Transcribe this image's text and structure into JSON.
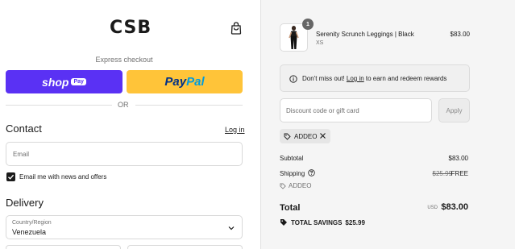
{
  "brand": {
    "logo_text": "CSB"
  },
  "express": {
    "label": "Express checkout",
    "shop_word": "shop",
    "shop_badge": "Pay",
    "paypal_a": "Pay",
    "paypal_b": "Pal",
    "or_text": "OR"
  },
  "contact": {
    "heading": "Contact",
    "login_label": "Log in",
    "email_placeholder": "Email",
    "newsletter_label": "Email me with news and offers",
    "newsletter_checked": true
  },
  "delivery": {
    "heading": "Delivery",
    "country_label": "Country/Region",
    "country_value": "Venezuela"
  },
  "summary": {
    "item": {
      "quantity": "1",
      "name": "Serenity Scrunch Leggings | Black",
      "variant": "XS",
      "price": "$83.00"
    },
    "rewards": {
      "text_before": "Don't miss out! ",
      "link": "Log in",
      "text_after": " to earn and redeem rewards"
    },
    "discount_placeholder": "Discount code or gift card",
    "apply_label": "Apply",
    "applied_code": "ADDEO",
    "subtotal_label": "Subtotal",
    "subtotal_value": "$83.00",
    "shipping_label": "Shipping",
    "shipping_original": "$25.99",
    "shipping_value": "FREE",
    "shipping_code": "ADDEO",
    "total_label": "Total",
    "currency": "USD",
    "total_value": "$83.00",
    "savings_label": "TOTAL SAVINGS",
    "savings_value": "$25.99"
  },
  "colors": {
    "shop_pay": "#5a31f4",
    "paypal": "#ffc439",
    "paypal_dark": "#003087",
    "paypal_light": "#009cde"
  },
  "icons": [
    "shopping-bag-icon",
    "check-icon",
    "chevron-down-icon",
    "info-icon",
    "tag-icon",
    "close-icon",
    "help-icon"
  ]
}
